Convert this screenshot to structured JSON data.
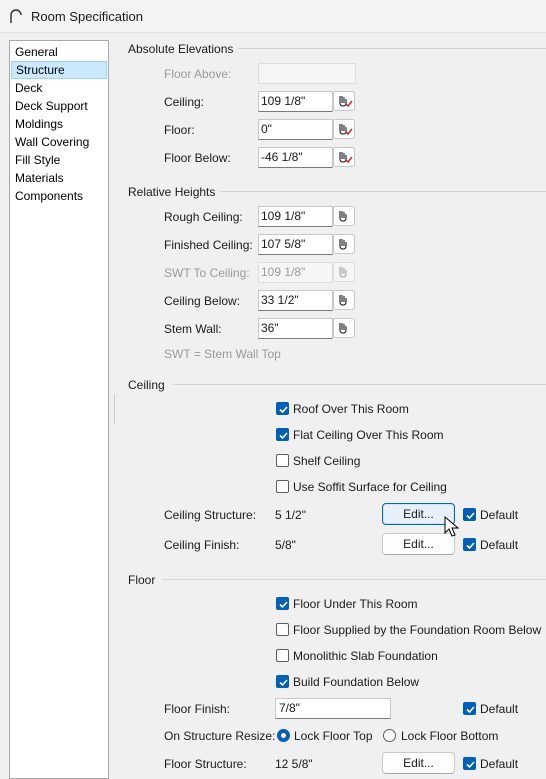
{
  "window": {
    "title": "Room Specification"
  },
  "nav": {
    "items": [
      "General",
      "Structure",
      "Deck",
      "Deck Support",
      "Moldings",
      "Wall Covering",
      "Fill Style",
      "Materials",
      "Components"
    ],
    "selected": "Structure"
  },
  "absolute_elevations": {
    "header": "Absolute Elevations",
    "floor_above": {
      "label": "Floor Above:",
      "value": ""
    },
    "ceiling": {
      "label": "Ceiling:",
      "value": "109 1/8\""
    },
    "floor": {
      "label": "Floor:",
      "value": "0\""
    },
    "floor_below": {
      "label": "Floor Below:",
      "value": "-46 1/8\""
    }
  },
  "relative_heights": {
    "header": "Relative Heights",
    "rough_ceiling": {
      "label": "Rough Ceiling:",
      "value": "109 1/8\""
    },
    "finished_ceiling": {
      "label": "Finished Ceiling:",
      "value": "107 5/8\""
    },
    "swt_to_ceiling": {
      "label": "SWT To Ceiling:",
      "value": "109 1/8\""
    },
    "ceiling_below": {
      "label": "Ceiling Below:",
      "value": "33 1/2\""
    },
    "stem_wall": {
      "label": "Stem Wall:",
      "value": "36\""
    },
    "note": "SWT = Stem Wall Top"
  },
  "ceiling": {
    "header": "Ceiling",
    "roof_over": {
      "label": "Roof Over This Room",
      "checked": true
    },
    "flat_ceiling": {
      "label": "Flat Ceiling Over This Room",
      "checked": true
    },
    "shelf_ceiling": {
      "label": "Shelf Ceiling",
      "checked": false
    },
    "soffit_surface": {
      "label": "Use Soffit Surface for Ceiling",
      "checked": false
    },
    "structure": {
      "label": "Ceiling Structure:",
      "value": "5 1/2\"",
      "button": "Edit...",
      "default_label": "Default",
      "default_checked": true
    },
    "finish": {
      "label": "Ceiling Finish:",
      "value": "5/8\"",
      "button": "Edit...",
      "default_label": "Default",
      "default_checked": true
    }
  },
  "floor": {
    "header": "Floor",
    "under_room": {
      "label": "Floor Under This Room",
      "checked": true
    },
    "supplied_by_foundation": {
      "label": "Floor Supplied by the Foundation Room Below",
      "checked": false
    },
    "monolithic_slab": {
      "label": "Monolithic Slab Foundation",
      "checked": false
    },
    "build_foundation": {
      "label": "Build Foundation Below",
      "checked": true
    },
    "finish": {
      "label": "Floor Finish:",
      "value": "7/8\"",
      "default_label": "Default",
      "default_checked": true
    },
    "resize": {
      "label": "On Structure Resize:",
      "option_top": "Lock Floor Top",
      "option_bottom": "Lock Floor Bottom",
      "selected": "Lock Floor Top"
    },
    "structure": {
      "label": "Floor Structure:",
      "value": "12 5/8\"",
      "button": "Edit...",
      "default_label": "Default",
      "default_checked": true
    }
  },
  "colors": {
    "accent": "#005fb8",
    "selection_bg": "#cce8ff",
    "picker_red": "#c42b1c"
  },
  "icons": {
    "title": "arch-icon",
    "picker": "eyedropper-picker-icon",
    "cursor": "mouse-pointer-icon"
  }
}
